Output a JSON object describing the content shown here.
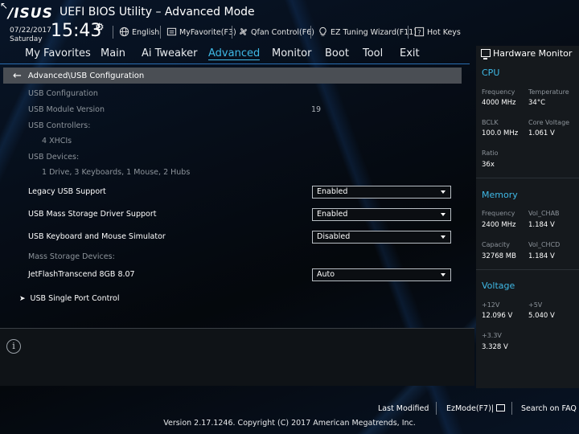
{
  "header": {
    "brand": "/ISUS",
    "title": "UEFI BIOS Utility – Advanced Mode",
    "date": "07/22/2017",
    "day": "Saturday",
    "time": "15:43",
    "shortcuts": {
      "language": "English",
      "myfavorite": "MyFavorite(F3)",
      "qfan": "Qfan Control(F6)",
      "ez_tuning": "EZ Tuning Wizard(F11)",
      "hot_keys": "Hot Keys"
    }
  },
  "menu": {
    "items": [
      "My Favorites",
      "Main",
      "Ai Tweaker",
      "Advanced",
      "Monitor",
      "Boot",
      "Tool",
      "Exit"
    ],
    "active": "Advanced"
  },
  "breadcrumb": "Advanced\\USB Configuration",
  "usb": {
    "section_title": "USB Configuration",
    "module_version_label": "USB Module Version",
    "module_version_value": "19",
    "controllers_label": "USB Controllers:",
    "controllers_value": "4 XHCIs",
    "devices_label": "USB Devices:",
    "devices_value": "1 Drive, 3 Keyboards, 1 Mouse, 2 Hubs",
    "legacy_label": "Legacy USB Support",
    "legacy_value": "Enabled",
    "mass_storage_driver_label": "USB Mass Storage Driver Support",
    "mass_storage_driver_value": "Enabled",
    "kbd_mouse_sim_label": "USB Keyboard and Mouse Simulator",
    "kbd_mouse_sim_value": "Disabled",
    "mass_storage_devices_label": "Mass Storage Devices:",
    "jetflash_label": "JetFlashTranscend 8GB 8.07",
    "jetflash_value": "Auto",
    "single_port_label": "USB Single Port Control"
  },
  "hw_monitor": {
    "title": "Hardware Monitor",
    "cpu": {
      "heading": "CPU",
      "frequency_label": "Frequency",
      "frequency_value": "4000 MHz",
      "temperature_label": "Temperature",
      "temperature_value": "34°C",
      "bclk_label": "BCLK",
      "bclk_value": "100.0 MHz",
      "core_voltage_label": "Core Voltage",
      "core_voltage_value": "1.061 V",
      "ratio_label": "Ratio",
      "ratio_value": "36x"
    },
    "memory": {
      "heading": "Memory",
      "frequency_label": "Frequency",
      "frequency_value": "2400 MHz",
      "vol_chab_label": "Vol_CHAB",
      "vol_chab_value": "1.184 V",
      "capacity_label": "Capacity",
      "capacity_value": "32768 MB",
      "vol_chcd_label": "Vol_CHCD",
      "vol_chcd_value": "1.184 V"
    },
    "voltage": {
      "heading": "Voltage",
      "v12_label": "+12V",
      "v12_value": "12.096 V",
      "v5_label": "+5V",
      "v5_value": "5.040 V",
      "v33_label": "+3.3V",
      "v33_value": "3.328 V"
    }
  },
  "footer": {
    "last_modified": "Last Modified",
    "ezmode": "EzMode(F7)|",
    "search_faq": "Search on FAQ",
    "copyright": "Version 2.17.1246. Copyright (C) 2017 American Megatrends, Inc."
  },
  "colors": {
    "accent": "#3fb9e6",
    "breadcrumb_bg": "#4a4e54",
    "panel_bg": "#15191d"
  }
}
